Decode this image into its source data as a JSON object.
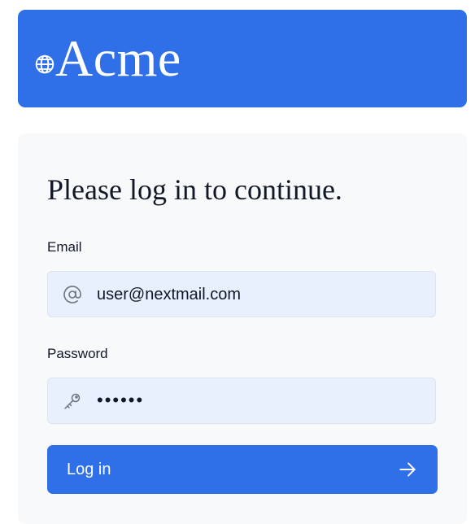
{
  "brand": {
    "name": "Acme",
    "logo_icon": "globe-icon",
    "color": "#2f6fe8"
  },
  "login": {
    "heading": "Please log in to continue.",
    "email": {
      "label": "Email",
      "value": "user@nextmail.com",
      "icon": "at-sign-icon"
    },
    "password": {
      "label": "Password",
      "value": "••••••",
      "icon": "key-icon"
    },
    "submit": {
      "label": "Log in",
      "icon": "arrow-right-icon"
    }
  }
}
